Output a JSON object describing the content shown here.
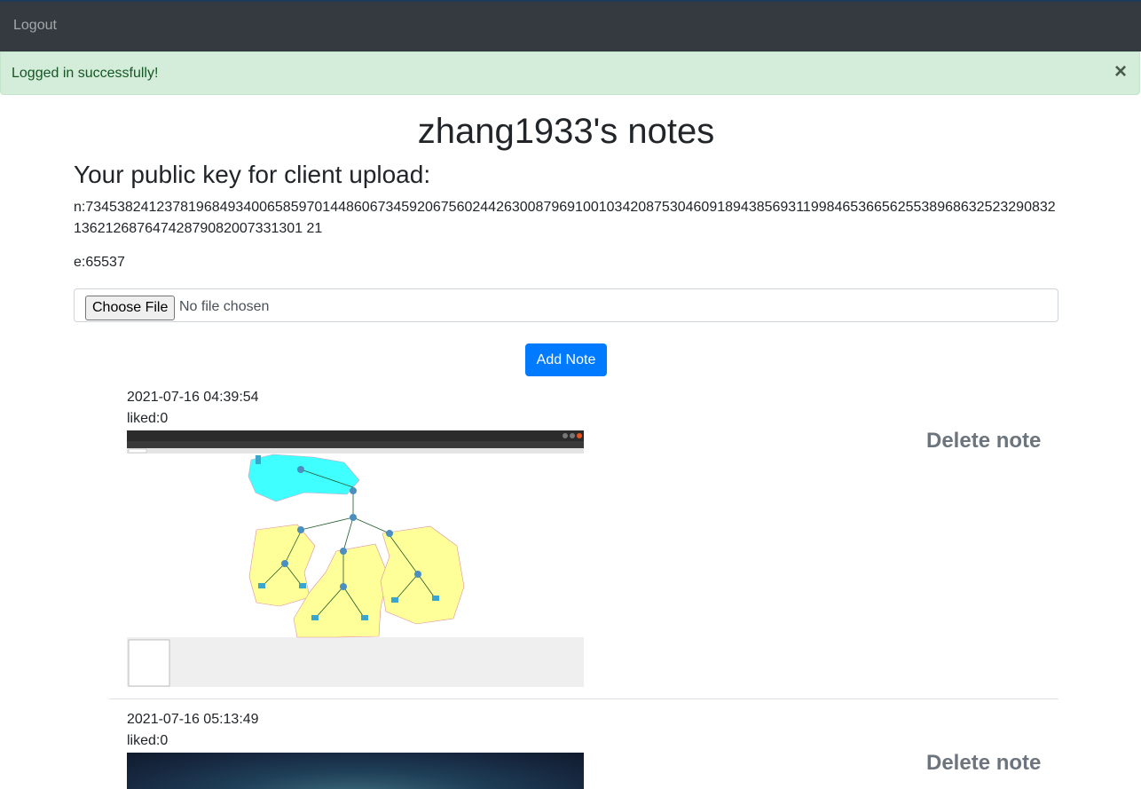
{
  "navbar": {
    "logout_label": "Logout"
  },
  "alert": {
    "message": "Logged in successfully!",
    "close_label": "×"
  },
  "page": {
    "title": "zhang1933's notes"
  },
  "public_key": {
    "heading": "Your public key for client upload:",
    "n_text": "n:73453824123781968493400658597014486067345920675602442630087969100103420875304609189438569311998465366562553896863252329083213621268764742879082007331301 21",
    "e_text": "e:65537"
  },
  "upload": {
    "button_label": "Choose File",
    "status": "No file chosen"
  },
  "add_note": {
    "label": "Add Note"
  },
  "notes": [
    {
      "date": "2021-07-16 04:39:54",
      "liked": "liked:0",
      "delete_label": "Delete note",
      "image_alt": "network topology screenshot"
    },
    {
      "date": "2021-07-16 05:13:49",
      "liked": "liked:0",
      "delete_label": "Delete note",
      "image_alt": "dark photo"
    }
  ],
  "colors": {
    "navbar": "#343a40",
    "alert_bg": "#d4edda",
    "alert_text": "#155724",
    "primary": "#007bff",
    "muted": "#6c757d"
  }
}
